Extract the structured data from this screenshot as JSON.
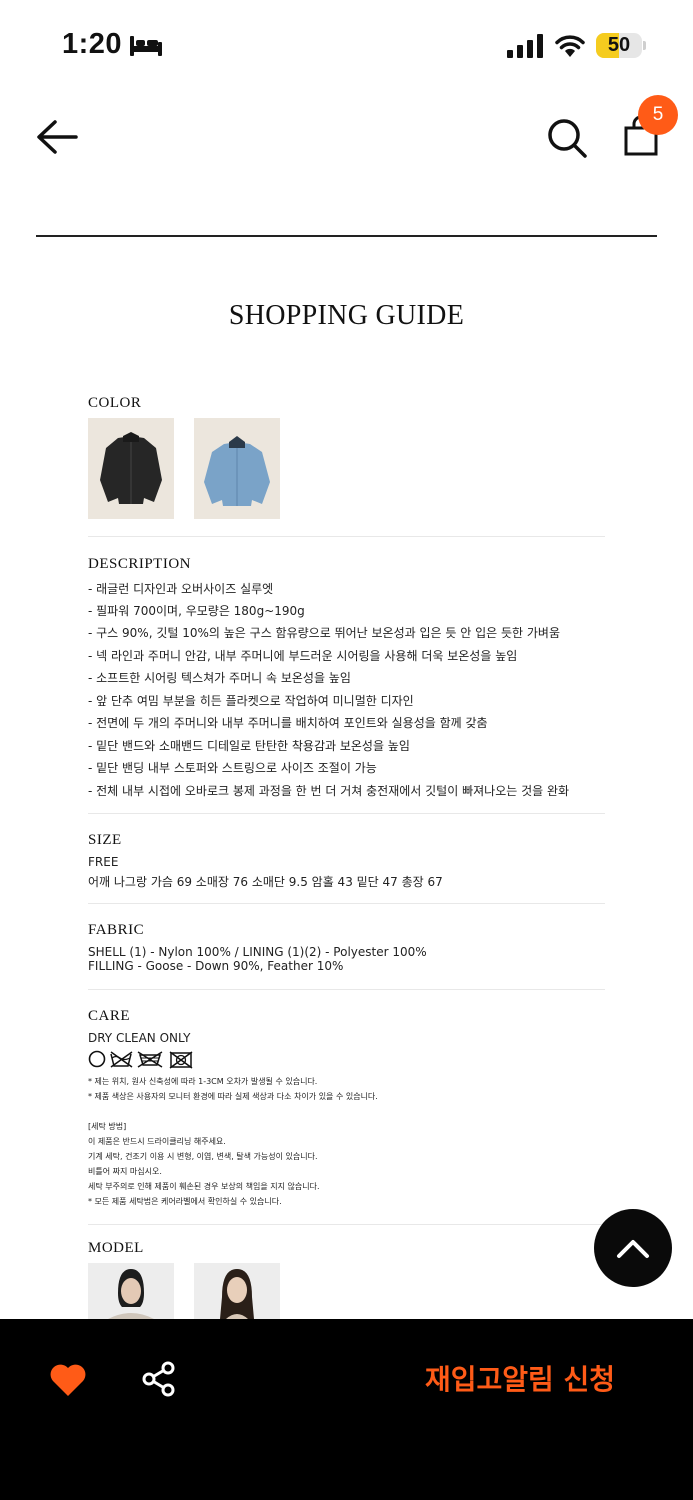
{
  "status_bar": {
    "time": "1:20",
    "battery_level": "50",
    "icons": [
      "bed-icon",
      "cellular-signal-icon",
      "wifi-icon",
      "battery-icon"
    ]
  },
  "header": {
    "icons": [
      "back-arrow-icon",
      "search-icon",
      "shopping-bag-icon"
    ],
    "cart_count": "5"
  },
  "page_title": "SHOPPING GUIDE",
  "color_section": {
    "title": "COLOR",
    "swatches": [
      "black-jacket",
      "light-blue-jacket"
    ],
    "swatch_colors": [
      "#262626",
      "#7aa3c8"
    ]
  },
  "description_section": {
    "title": "DESCRIPTION",
    "lines": [
      "- 래글런 디자인과 오버사이즈 실루엣",
      "- 필파워 700이며, 우모량은 180g~190g",
      "- 구스 90%, 깃털 10%의 높은 구스 함유량으로 뛰어난 보온성과 입은 듯 안 입은 듯한 가벼움",
      "- 넥 라인과 주머니 안감, 내부 주머니에 부드러운 시어링을 사용해 더욱 보온성을 높임",
      "- 소프트한 시어링 텍스쳐가 주머니 속 보온성을 높임",
      "- 앞 단추 여밈 부분을 히든 플라켓으로 작업하여 미니멀한 디자인",
      "- 전면에 두 개의 주머니와 내부 주머니를 배치하여 포인트와 실용성을 함께 갖춤",
      "- 밑단 밴드와 소매밴드 디테일로 탄탄한 착용감과 보온성을 높임",
      "- 밑단 밴딩 내부 스토퍼와 스트링으로 사이즈 조절이 가능",
      "- 전체 내부 시접에 오바로크 봉제 과정을 한 번 더 거쳐 충전재에서 깃털이 빠져나오는 것을 완화"
    ]
  },
  "size_section": {
    "title": "SIZE",
    "size_name": "FREE",
    "measurements": "어깨 나그랑  가슴 69  소매장 76  소매단 9.5  암홀 43  밑단 47  총장 67"
  },
  "fabric_section": {
    "title": "FABRIC",
    "line1": "SHELL (1) - Nylon 100%  /  LINING (1)(2) - Polyester 100%",
    "line2": "FILLING - Goose - Down 90%, Feather 10%"
  },
  "care_section": {
    "title": "CARE",
    "instruction": "DRY CLEAN ONLY",
    "care_icons": [
      "dry-clean-icon",
      "no-wash-icon",
      "no-tumble-dry-icon",
      "no-wring-icon"
    ],
    "notes": [
      "* 제는 위치, 원사 신축성에 따라 1-3CM 오차가 발생될 수 있습니다.",
      "* 제품 색상은 사용자의 모니터 환경에 따라 실제 색상과 다소 차이가 있을 수 있습니다."
    ],
    "wash_title": "[세탁 방법]",
    "wash_lines": [
      "이 제품은 반드시 드라이클리닝 해주세요.",
      "기계 세탁, 건조기 이용 시 변형, 이염, 변색, 탈색 가능성이 있습니다.",
      "비틀어 짜지 마십시오.",
      "세탁 부주의로 인해 제품이 훼손된 경우 보상의 책임을 지지 않습니다.",
      "* 모든 제품 세탁법은 케어라벨에서 확인하실 수 있습니다."
    ]
  },
  "model_section": {
    "title": "MODEL",
    "photos": [
      "model-photo-1",
      "model-photo-2"
    ]
  },
  "floating": {
    "icon": "chevron-up-icon"
  },
  "bottom_bar": {
    "icons": [
      "heart-icon",
      "share-icon"
    ],
    "accent_color": "#ff5b17",
    "restock_label": "재입고알림 신청"
  }
}
